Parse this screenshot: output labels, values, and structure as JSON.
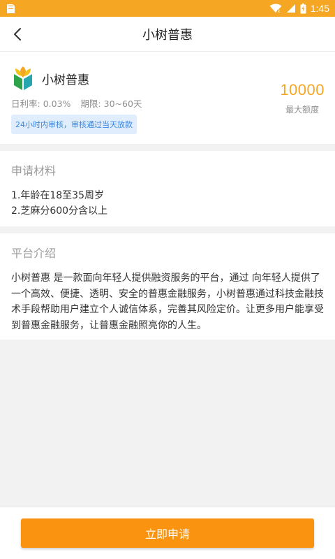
{
  "status_bar": {
    "time": "1:45",
    "icons": [
      "sd-card-icon",
      "wifi-icon",
      "signal-icon",
      "battery-icon"
    ],
    "color": "#f5a623"
  },
  "nav": {
    "title": "小树普惠",
    "back_icon": "chevron-left-icon"
  },
  "product": {
    "name": "小树普惠",
    "logo_icon": "leaf-logo-icon",
    "daily_rate_label": "日利率:",
    "daily_rate": "0.03%",
    "term_label": "期限:",
    "term": "30~60天",
    "tag": "24小时内审核，审核通过当天放款",
    "max_amount": "10000",
    "max_amount_label": "最大额度",
    "accent_color": "#f5a623"
  },
  "materials": {
    "title": "申请材料",
    "items": [
      "1.年龄在18至35周岁",
      "2.芝麻分600分含以上"
    ]
  },
  "intro": {
    "title": "平台介绍",
    "lines": [
      "小树普惠 是一款面向年轻人提供融资服务的平台，通过 向年轻人提供了",
      "一个高效、便捷、透明、安全的普惠金融服务，小树普惠通过科技金融技",
      "术手段帮助用户建立个人诚信体系，完善其风险定价。让更多用户能享受",
      "到普惠金融服务，让普惠金融照亮你的人生。"
    ]
  },
  "footer": {
    "apply_label": "立即申请",
    "button_color": "#fa9410"
  }
}
